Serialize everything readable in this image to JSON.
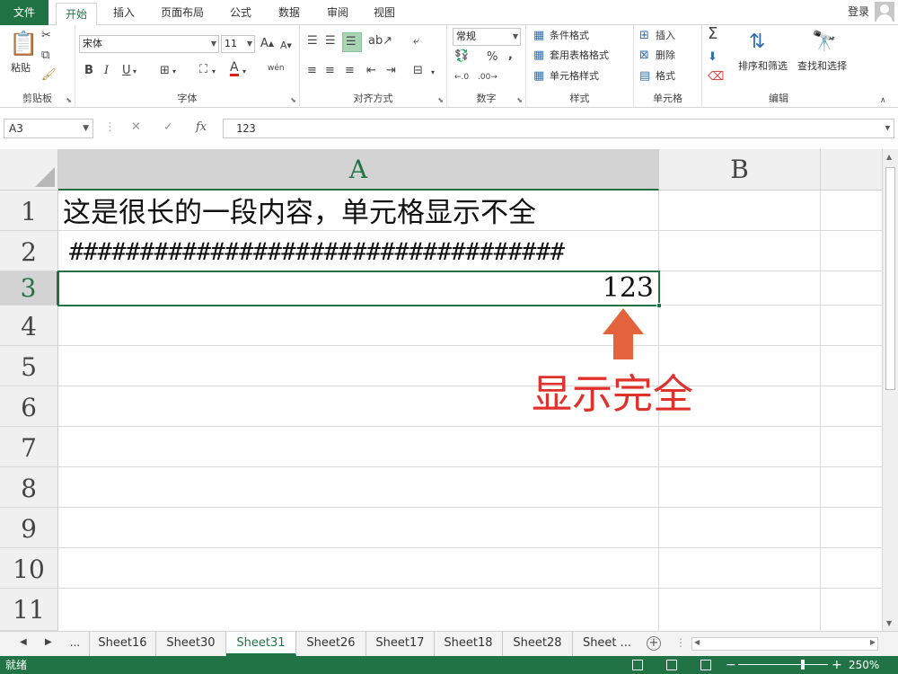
{
  "ribbon_tabs": [
    "文件",
    "开始",
    "插入",
    "页面布局",
    "公式",
    "数据",
    "审阅",
    "视图"
  ],
  "login_label": "登录",
  "clipboard": {
    "paste": "粘贴",
    "label": "剪贴板"
  },
  "font": {
    "name": "宋体",
    "size": "11",
    "label": "字体",
    "bold": "B",
    "italic": "I",
    "underline": "U",
    "font_color_glyph": "A",
    "phonetic": "wén"
  },
  "alignment": {
    "label": "对齐方式"
  },
  "number": {
    "format": "常规",
    "percent": "%",
    "comma": ",",
    "label": "数字"
  },
  "styles": {
    "conditional": "条件格式",
    "table": "套用表格格式",
    "cell": "单元格样式",
    "label": "样式"
  },
  "cells": {
    "insert": "插入",
    "delete": "删除",
    "format": "格式",
    "label": "单元格"
  },
  "editing": {
    "sum_glyph": "Σ",
    "sort": "排序和筛选",
    "find": "查找和选择",
    "label": "编辑"
  },
  "formula_bar": {
    "name_box": "A3",
    "content": "123",
    "fx": "fx"
  },
  "columns": [
    "A",
    "B"
  ],
  "rows": [
    "1",
    "2",
    "3",
    "4",
    "5",
    "6",
    "7",
    "8",
    "9",
    "10",
    "11"
  ],
  "cells_data": {
    "a1": "这是很长的一段内容，单元格显示不全",
    "a2": "###################################",
    "a3": "123"
  },
  "annotation": "显示完全",
  "sheets": [
    "Sheet16",
    "Sheet30",
    "Sheet31",
    "Sheet26",
    "Sheet17",
    "Sheet18",
    "Sheet28",
    "Sheet ..."
  ],
  "active_sheet": "Sheet31",
  "ellipsis": "...",
  "status": "就绪",
  "zoom": "250%",
  "colors": {
    "accent": "#217346",
    "arrow": "#e3643c",
    "annotation": "#e0322d"
  }
}
